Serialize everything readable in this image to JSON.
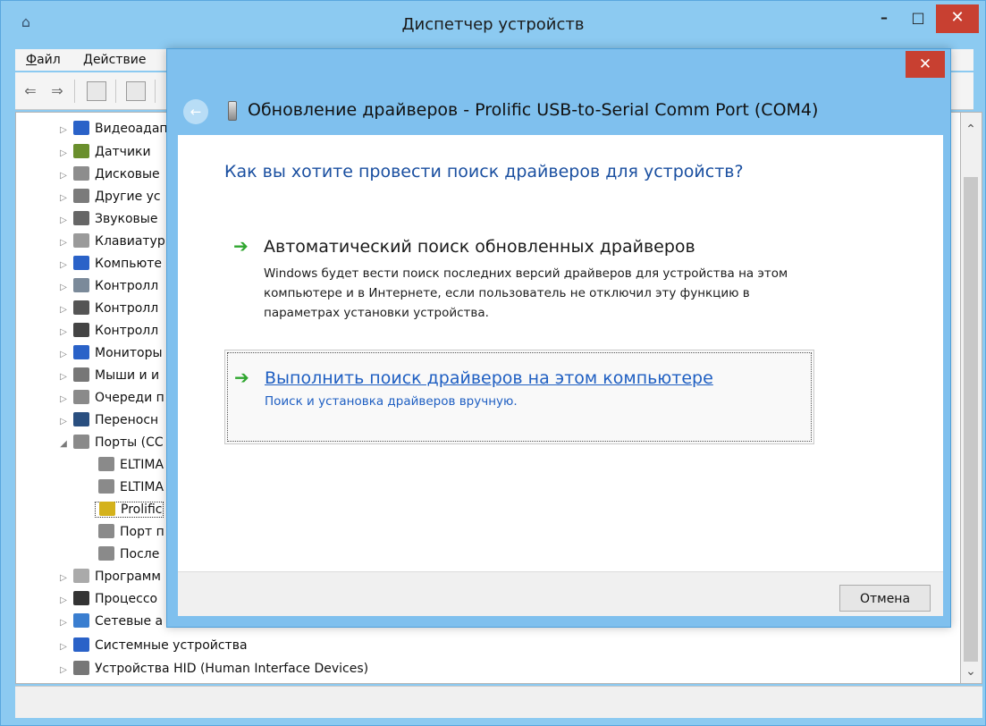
{
  "window": {
    "title": "Диспетчер устройств",
    "minimize": "–",
    "maximize": "□",
    "close": "✕"
  },
  "menu": {
    "file": "Файл",
    "action": "Действие"
  },
  "toolbar": {
    "back_icon": "⇐",
    "forward_icon": "⇒"
  },
  "tree": [
    {
      "label": "Видеоадап",
      "arrow": "▷",
      "color": "#2a62c8"
    },
    {
      "label": "Датчики",
      "arrow": "▷",
      "color": "#6a8f2d"
    },
    {
      "label": "Дисковые",
      "arrow": "▷",
      "color": "#8d8d8d"
    },
    {
      "label": "Другие ус",
      "arrow": "▷",
      "color": "#7b7b7b"
    },
    {
      "label": "Звуковые",
      "arrow": "▷",
      "color": "#666666"
    },
    {
      "label": "Клавиатур",
      "arrow": "▷",
      "color": "#9a9a9a"
    },
    {
      "label": "Компьюте",
      "arrow": "▷",
      "color": "#2a62c8"
    },
    {
      "label": "Контролл",
      "arrow": "▷",
      "color": "#7b8a9a"
    },
    {
      "label": "Контролл",
      "arrow": "▷",
      "color": "#555555"
    },
    {
      "label": "Контролл",
      "arrow": "▷",
      "color": "#444444"
    },
    {
      "label": "Мониторы",
      "arrow": "▷",
      "color": "#2a62c8"
    },
    {
      "label": "Мыши и и",
      "arrow": "▷",
      "color": "#777777"
    },
    {
      "label": "Очереди п",
      "arrow": "▷",
      "color": "#8a8a8a"
    },
    {
      "label": "Переносн",
      "arrow": "▷",
      "color": "#2a4f80"
    },
    {
      "label": "Порты (CC",
      "arrow": "◢",
      "color": "#8a8a8a"
    },
    {
      "label": "ELTIMA",
      "arrow": "",
      "color": "#8a8a8a"
    },
    {
      "label": "ELTIMA",
      "arrow": "",
      "color": "#8a8a8a"
    },
    {
      "label": "Prolific",
      "arrow": "",
      "color": "#d4b21c"
    },
    {
      "label": "Порт п",
      "arrow": "",
      "color": "#8a8a8a"
    },
    {
      "label": "После",
      "arrow": "",
      "color": "#8a8a8a"
    },
    {
      "label": "Программ",
      "arrow": "▷",
      "color": "#aaaaaa"
    },
    {
      "label": "Процессо",
      "arrow": "▷",
      "color": "#333333"
    },
    {
      "label": "Сетевые а",
      "arrow": "▷",
      "color": "#3a7ed0"
    },
    {
      "label": "Системные устройства",
      "arrow": "▷",
      "color": "#2a62c8"
    },
    {
      "label": "Устройства HID (Human Interface Devices)",
      "arrow": "▷",
      "color": "#777777"
    }
  ],
  "scrollbar": {
    "up": "⌃",
    "down": "⌄"
  },
  "dialog": {
    "close": "✕",
    "back": "←",
    "title": "Обновление драйверов - Prolific USB-to-Serial Comm Port (COM4)",
    "question": "Как вы хотите провести поиск драйверов для устройств?",
    "options": [
      {
        "arrow": "➔",
        "title": "Автоматический поиск обновленных драйверов",
        "description": "Windows будет вести поиск последних версий драйверов для устройства на этом компьютере и в Интернете, если пользователь не отключил эту функцию в параметрах установки устройства."
      },
      {
        "arrow": "➔",
        "title": "Выполнить поиск драйверов на этом компьютере",
        "description": "Поиск и установка драйверов вручную."
      }
    ],
    "cancel": "Отмена"
  }
}
